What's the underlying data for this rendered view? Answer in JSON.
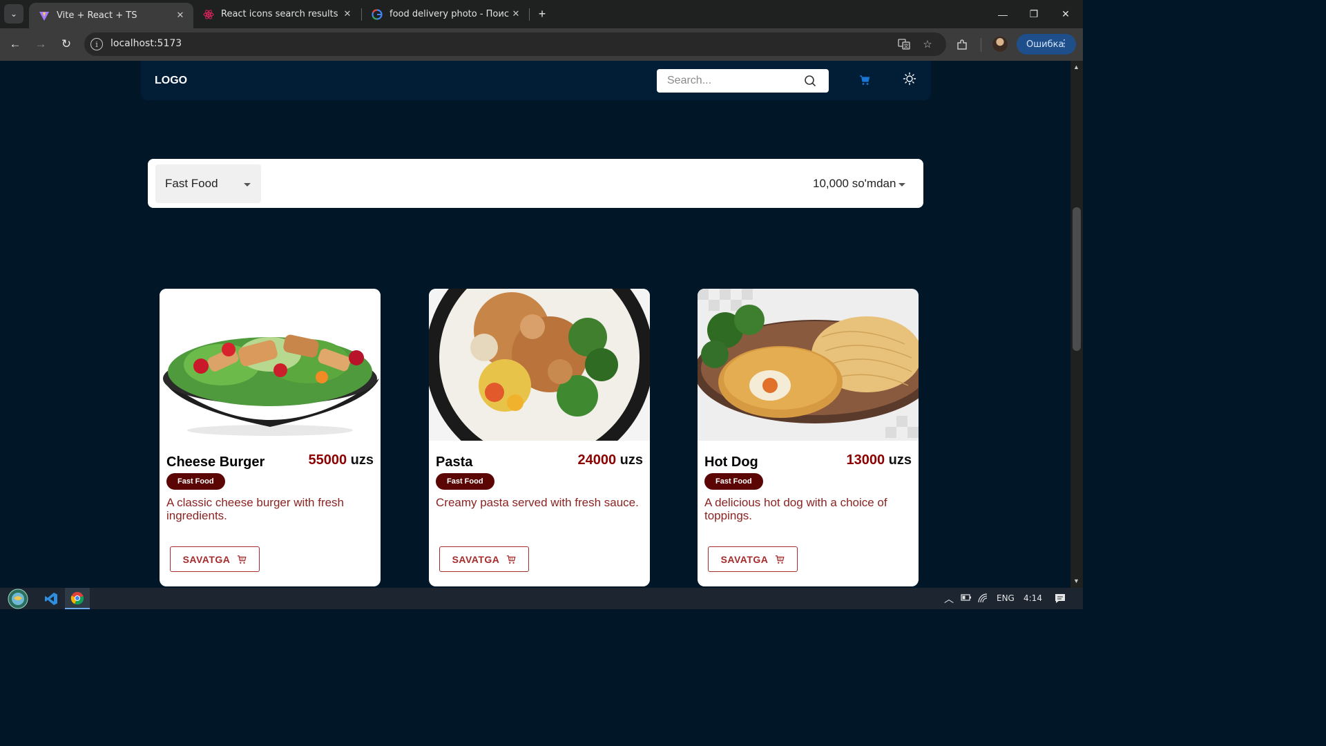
{
  "browser": {
    "tabs": [
      {
        "title": "Vite + React + TS",
        "active": true,
        "icon": "vite-icon"
      },
      {
        "title": "React icons search results",
        "active": false,
        "icon": "react-icon"
      },
      {
        "title": "food delivery photo - Поиск в Google",
        "active": false,
        "icon": "google-icon"
      }
    ],
    "url": "localhost:5173",
    "profile_button": "Ошибка"
  },
  "header": {
    "logo": "LOGO",
    "search_placeholder": "Search..."
  },
  "filters": {
    "category": "Fast Food",
    "price": "10,000 so'mdan"
  },
  "products": [
    {
      "title": "Cheese Burger",
      "price": "55000",
      "currency": "uzs",
      "category": "Fast Food",
      "description": "A classic cheese burger with fresh ingredients.",
      "button": "SAVATGA"
    },
    {
      "title": "Pasta",
      "price": "24000",
      "currency": "uzs",
      "category": "Fast Food",
      "description": "Creamy pasta served with fresh sauce.",
      "button": "SAVATGA"
    },
    {
      "title": "Hot Dog",
      "price": "13000",
      "currency": "uzs",
      "category": "Fast Food",
      "description": "A delicious hot dog with a choice of toppings.",
      "button": "SAVATGA"
    }
  ],
  "taskbar": {
    "language": "ENG",
    "time": "4:14"
  },
  "colors": {
    "page_bg": "#011627",
    "price": "#8b0000",
    "badge_bg": "#5c0505",
    "button_accent": "#a52a2a",
    "cart_icon": "#1976d2"
  }
}
